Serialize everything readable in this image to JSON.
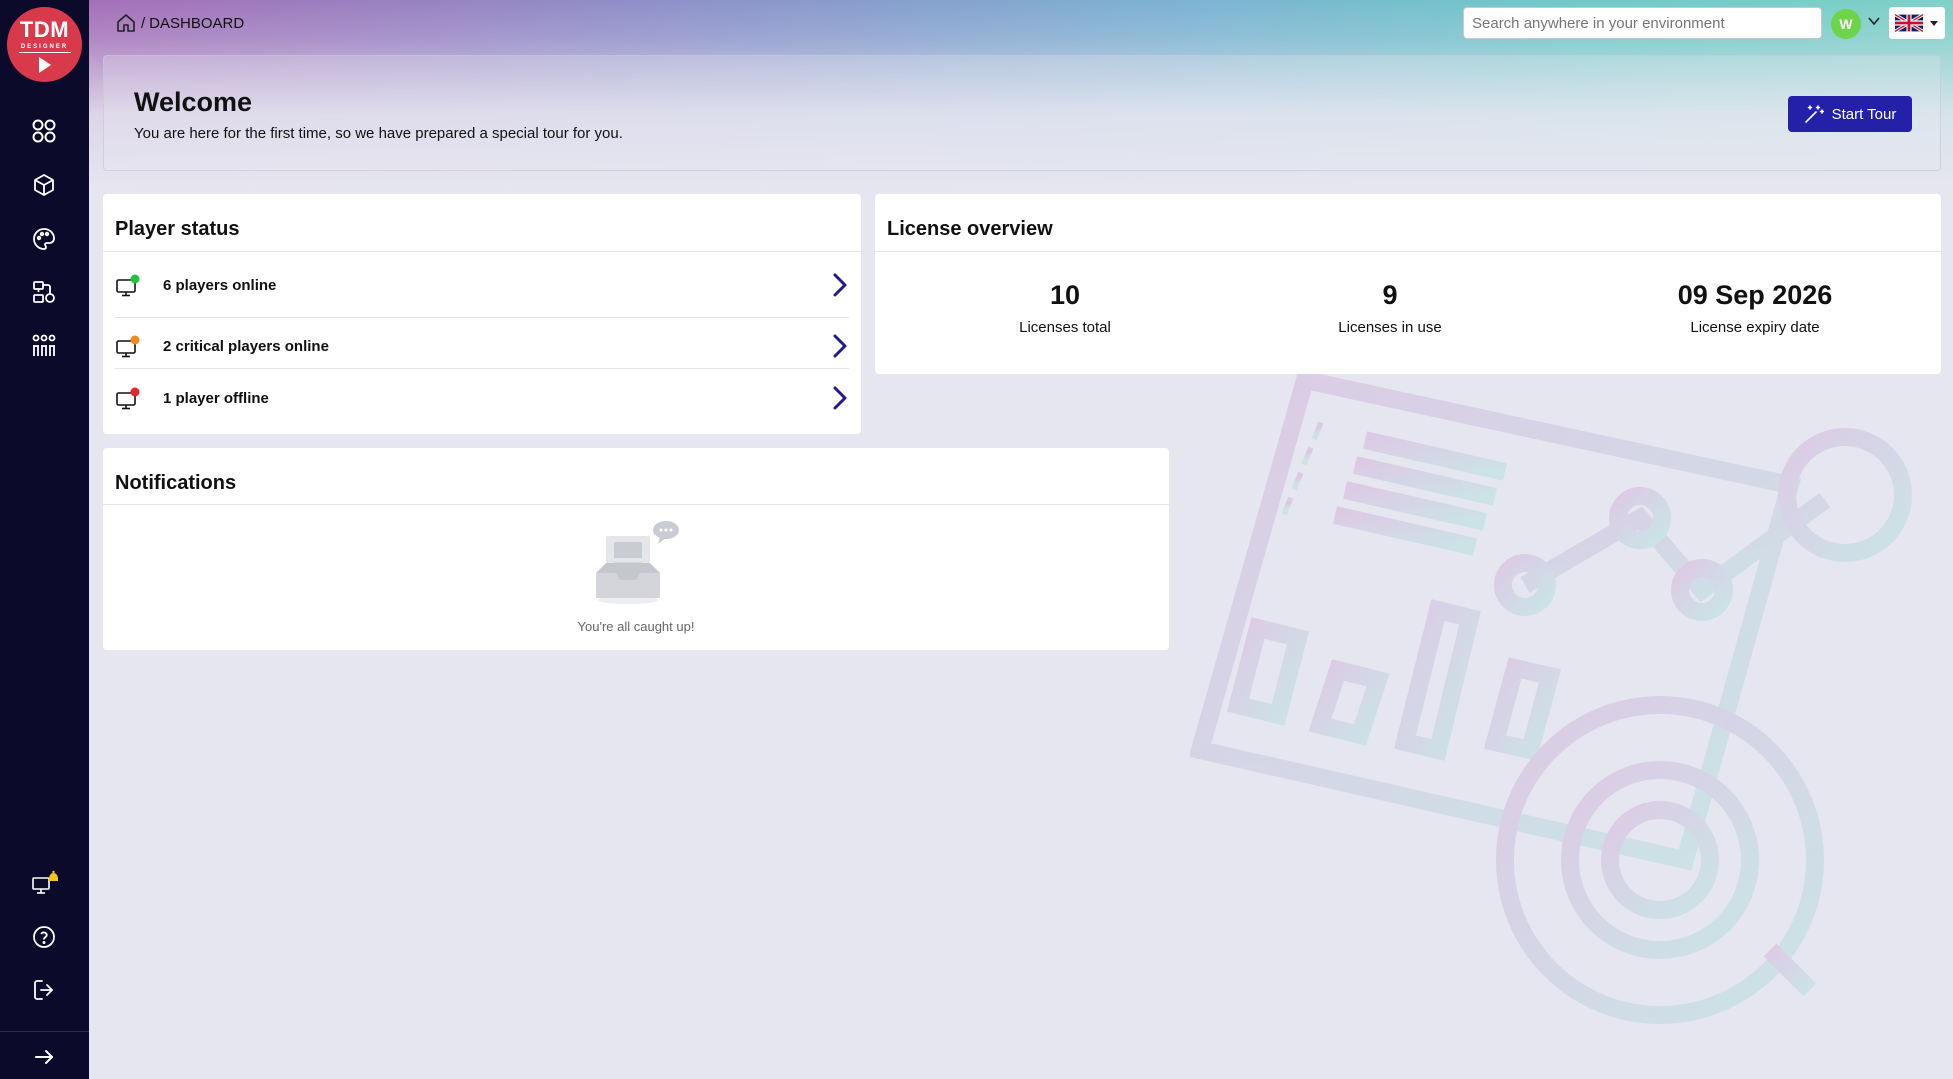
{
  "breadcrumb": {
    "home_icon": "home-icon",
    "separator": "/",
    "current": "DASHBOARD"
  },
  "search": {
    "placeholder": "Search anywhere in your environment"
  },
  "user": {
    "initial": "W",
    "color": "#6ed44a"
  },
  "language": {
    "flag": "uk-flag-icon"
  },
  "logo": {
    "line1": "TDM",
    "line2": "DESIGNER"
  },
  "sidebar": {
    "items": [
      {
        "name": "dashboard",
        "icon": "grid-icon"
      },
      {
        "name": "content",
        "icon": "cube-icon"
      },
      {
        "name": "design",
        "icon": "palette-icon"
      },
      {
        "name": "players",
        "icon": "devices-icon"
      },
      {
        "name": "users",
        "icon": "team-icon"
      }
    ],
    "bottom_items": [
      {
        "name": "notifications",
        "icon": "bell-monitor-icon"
      },
      {
        "name": "help",
        "icon": "question-icon"
      },
      {
        "name": "logout",
        "icon": "logout-icon"
      }
    ],
    "expand_icon": "arrow-right-icon"
  },
  "welcome": {
    "title": "Welcome",
    "subtitle": "You are here for the first time, so we have prepared a special tour for you.",
    "tour_button": "Start Tour"
  },
  "player_status": {
    "title": "Player status",
    "rows": [
      {
        "label": "6 players online",
        "status_color": "#22c33a"
      },
      {
        "label": "2 critical players online",
        "status_color": "#f08a1c"
      },
      {
        "label": "1 player offline",
        "status_color": "#e8242a"
      }
    ]
  },
  "license_overview": {
    "title": "License overview",
    "items": [
      {
        "value": "10",
        "label": "Licenses total"
      },
      {
        "value": "9",
        "label": "Licenses in use"
      },
      {
        "value": "09 Sep 2026",
        "label": "License expiry date"
      }
    ]
  },
  "notifications": {
    "title": "Notifications",
    "empty_message": "You're all caught up!"
  },
  "colors": {
    "sidebar": "#0c0a2b",
    "accent": "#2421a8",
    "brand": "#d93a4b"
  }
}
